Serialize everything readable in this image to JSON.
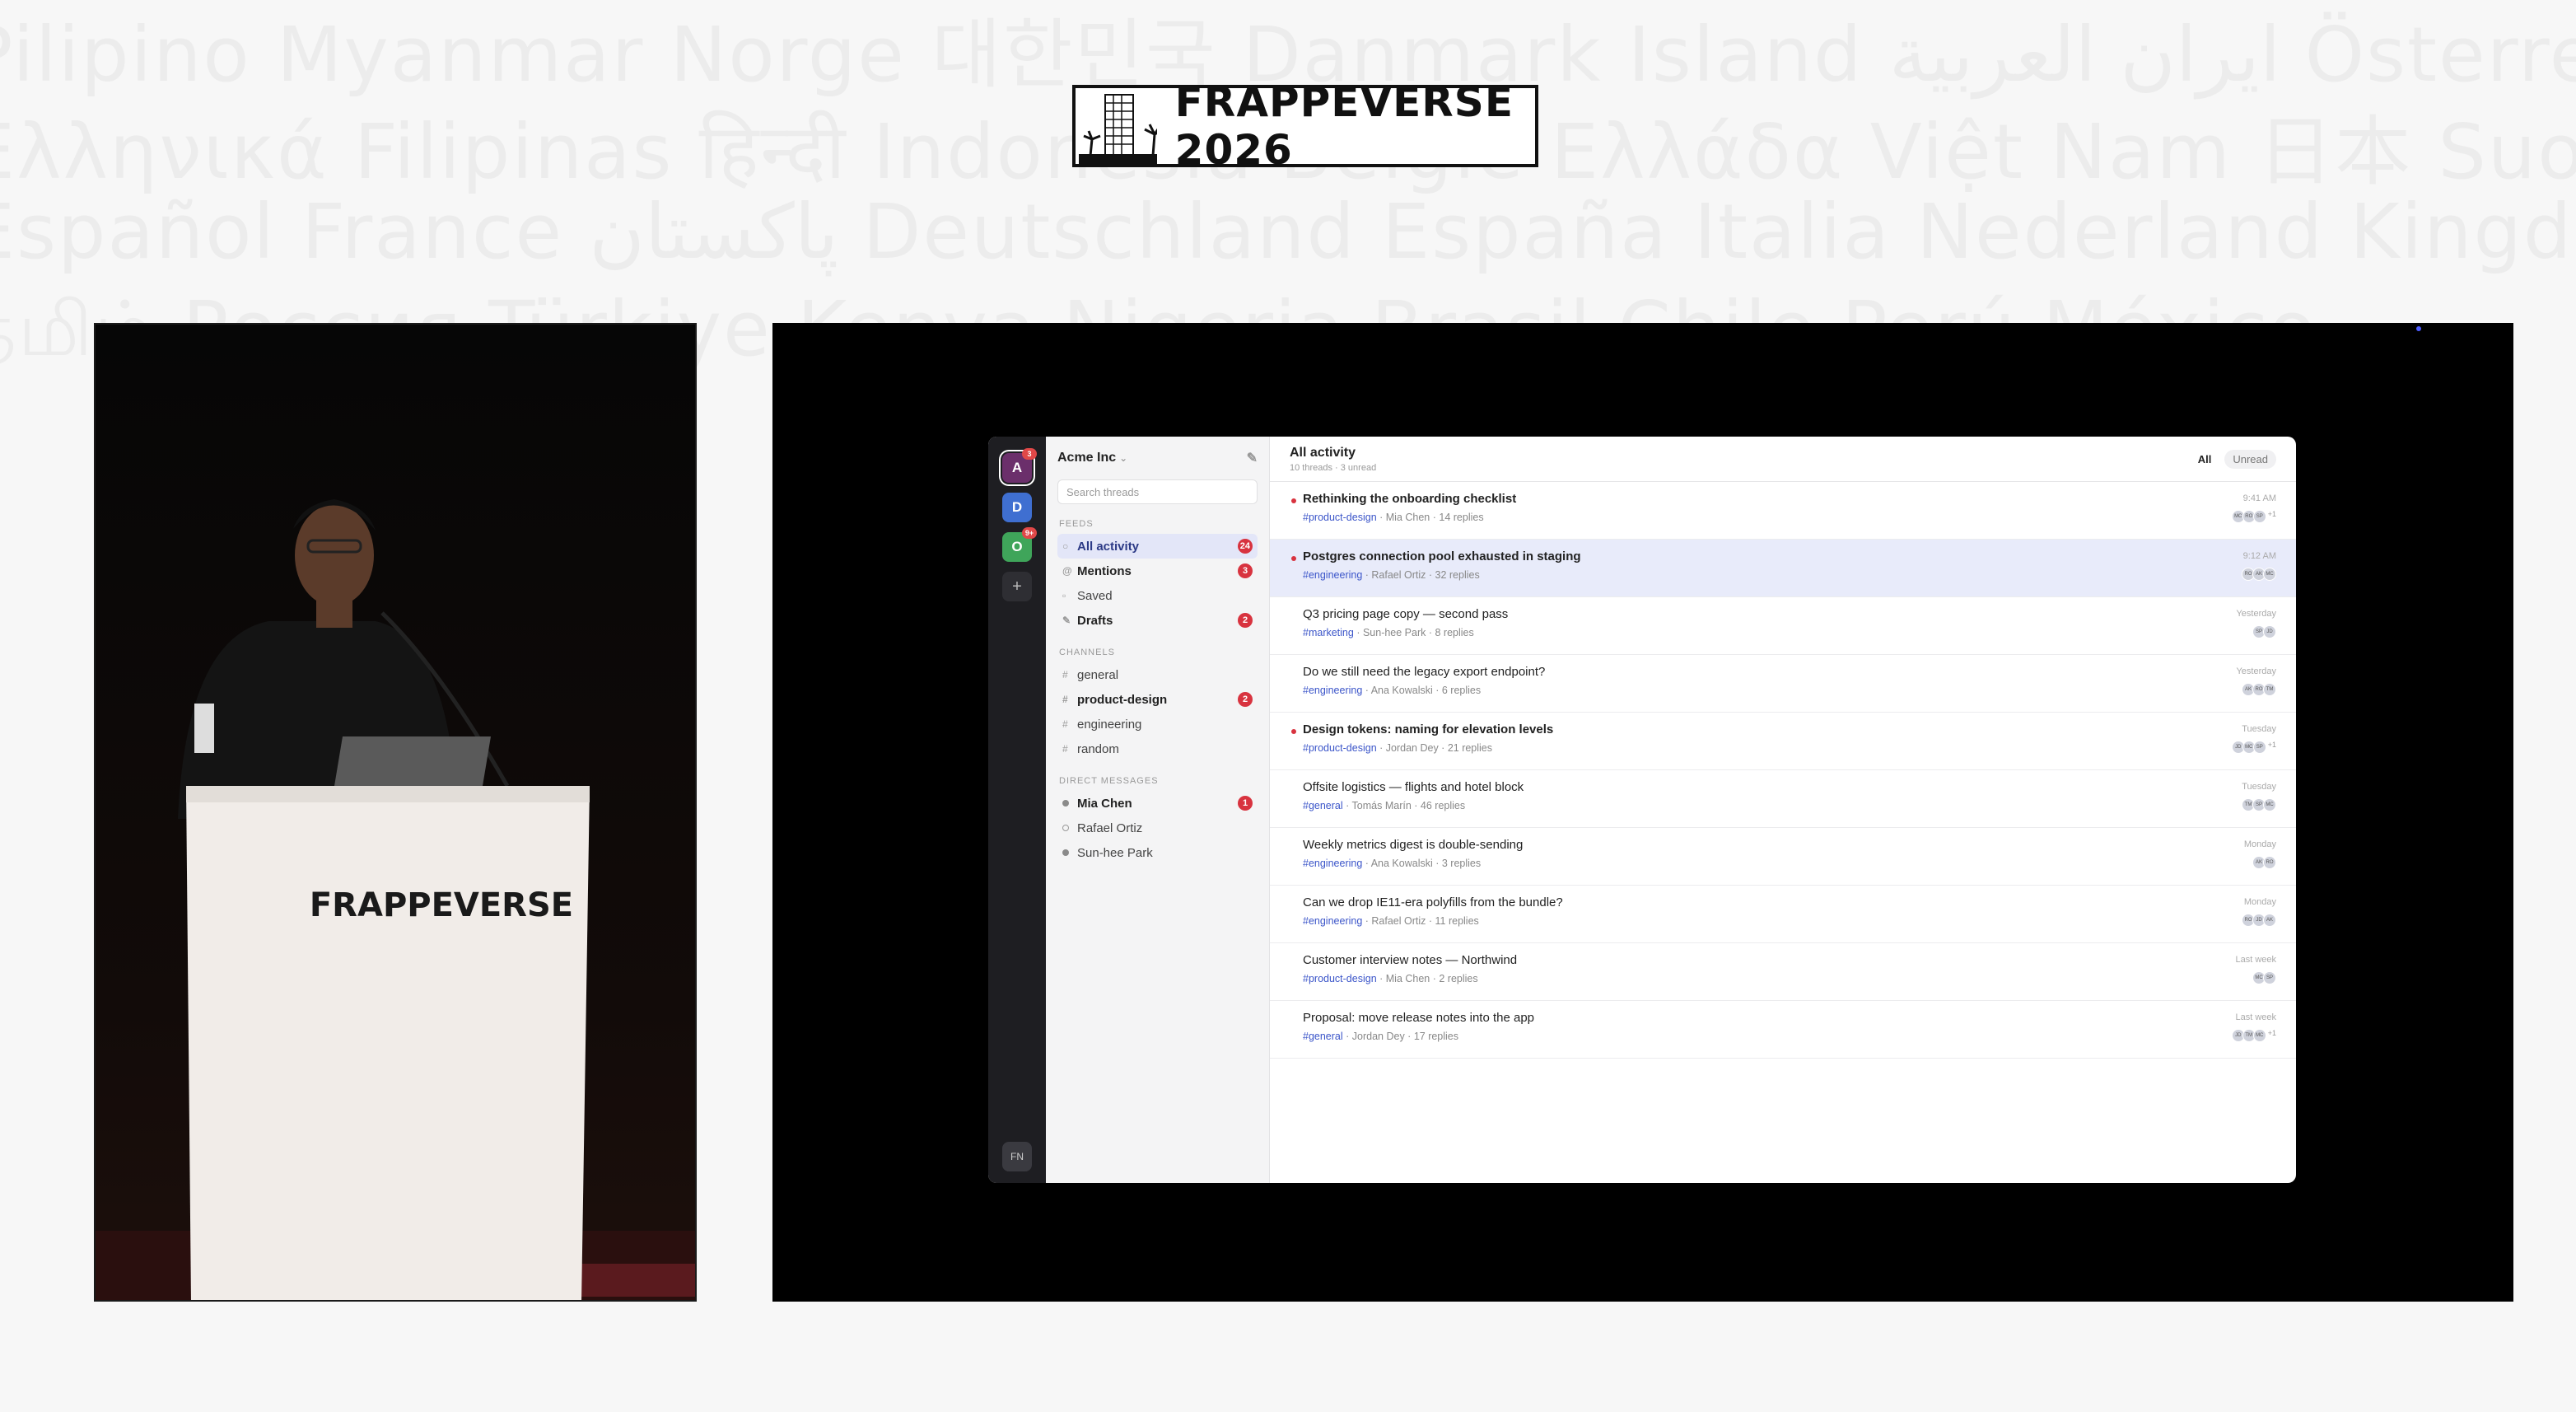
{
  "backdrop": [
    "Pilipino  Myanmar  Norge 대한민국 Danmark Island ایران العربية Österreich",
    "Ελληνικά Filipinas हिन्दी Indonesia België Ελλάδα Việt Nam 日本 Suomi বাংলাদেশ",
    "Español France پاکستان Deutschland España Italia Nederland Kingdom",
    "தமிழ் Россия Türkiye Kenya Nigeria Brasil Chile Perú México"
  ],
  "event": {
    "title": "FRAPPEVERSE 2026",
    "podium_text": "FRAPPEVERSE"
  },
  "app": {
    "workspaces": [
      {
        "initial": "A",
        "color": "#6b2f6b",
        "badge": "3",
        "active": true
      },
      {
        "initial": "D",
        "color": "#3f6fd1",
        "badge": ""
      },
      {
        "initial": "O",
        "color": "#3fa55a",
        "badge": "9+"
      }
    ],
    "add_workspace": "+",
    "user_initials": "FN",
    "sidebar": {
      "workspace_name": "Acme Inc",
      "search_placeholder": "Search threads",
      "feeds_label": "FEEDS",
      "feeds": [
        {
          "label": "All activity",
          "icon": "○",
          "count": "24",
          "active": true
        },
        {
          "label": "Mentions",
          "icon": "@",
          "count": "3",
          "bold": true
        },
        {
          "label": "Saved",
          "icon": "▫",
          "count": ""
        },
        {
          "label": "Drafts",
          "icon": "✎",
          "count": "2",
          "bold": true
        }
      ],
      "channels_label": "CHANNELS",
      "channels": [
        {
          "label": "general",
          "count": ""
        },
        {
          "label": "product-design",
          "count": "2",
          "bold": true
        },
        {
          "label": "engineering",
          "count": ""
        },
        {
          "label": "random",
          "count": ""
        }
      ],
      "dm_label": "DIRECT MESSAGES",
      "dms": [
        {
          "name": "Mia Chen",
          "count": "1",
          "status": "online",
          "bold": true
        },
        {
          "name": "Rafael Ortiz",
          "count": "",
          "status": "away"
        },
        {
          "name": "Sun-hee Park",
          "count": "",
          "status": "online"
        }
      ]
    },
    "main": {
      "title": "All activity",
      "subtitle": "10 threads · 3 unread",
      "filter_all": "All",
      "filter_unread": "Unread",
      "threads": [
        {
          "title": "Rethinking the onboarding checklist",
          "channel": "#product-design",
          "author": "Mia Chen",
          "replies": "14 replies",
          "time": "9:41 AM",
          "avatars": [
            "MC",
            "RO",
            "SP"
          ],
          "more": "+1",
          "unread": true
        },
        {
          "title": "Postgres connection pool exhausted in staging",
          "channel": "#engineering",
          "author": "Rafael Ortiz",
          "replies": "32 replies",
          "time": "9:12 AM",
          "avatars": [
            "RO",
            "AK",
            "MC"
          ],
          "more": "",
          "unread": true,
          "selected": true
        },
        {
          "title": "Q3 pricing page copy — second pass",
          "channel": "#marketing",
          "author": "Sun-hee Park",
          "replies": "8 replies",
          "time": "Yesterday",
          "avatars": [
            "SP",
            "JD"
          ],
          "more": ""
        },
        {
          "title": "Do we still need the legacy export endpoint?",
          "channel": "#engineering",
          "author": "Ana Kowalski",
          "replies": "6 replies",
          "time": "Yesterday",
          "avatars": [
            "AK",
            "RO",
            "TM"
          ],
          "more": ""
        },
        {
          "title": "Design tokens: naming for elevation levels",
          "channel": "#product-design",
          "author": "Jordan Dey",
          "replies": "21 replies",
          "time": "Tuesday",
          "avatars": [
            "JD",
            "MC",
            "SP"
          ],
          "more": "+1",
          "unread": true
        },
        {
          "title": "Offsite logistics — flights and hotel block",
          "channel": "#general",
          "author": "Tomás Marín",
          "replies": "46 replies",
          "time": "Tuesday",
          "avatars": [
            "TM",
            "SP",
            "MC"
          ],
          "more": ""
        },
        {
          "title": "Weekly metrics digest is double-sending",
          "channel": "#engineering",
          "author": "Ana Kowalski",
          "replies": "3 replies",
          "time": "Monday",
          "avatars": [
            "AK",
            "RO"
          ],
          "more": ""
        },
        {
          "title": "Can we drop IE11-era polyfills from the bundle?",
          "channel": "#engineering",
          "author": "Rafael Ortiz",
          "replies": "11 replies",
          "time": "Monday",
          "avatars": [
            "RO",
            "JD",
            "AK"
          ],
          "more": ""
        },
        {
          "title": "Customer interview notes — Northwind",
          "channel": "#product-design",
          "author": "Mia Chen",
          "replies": "2 replies",
          "time": "Last week",
          "avatars": [
            "MC",
            "SP"
          ],
          "more": ""
        },
        {
          "title": "Proposal: move release notes into the app",
          "channel": "#general",
          "author": "Jordan Dey",
          "replies": "17 replies",
          "time": "Last week",
          "avatars": [
            "JD",
            "TM",
            "MC"
          ],
          "more": "+1"
        }
      ]
    }
  }
}
